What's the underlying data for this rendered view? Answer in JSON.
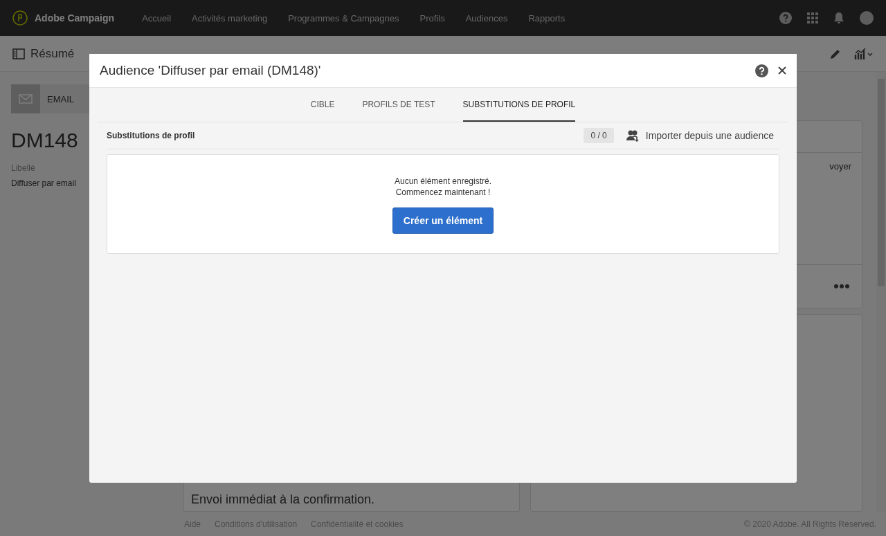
{
  "nav": {
    "brand": "Adobe Campaign",
    "items": [
      "Accueil",
      "Activités marketing",
      "Programmes & Campagnes",
      "Profils",
      "Audiences",
      "Rapports"
    ]
  },
  "subbar": {
    "label": "Résumé"
  },
  "left_panel": {
    "tab": "EMAIL",
    "name": "DM148",
    "field_label": "Libellé",
    "field_value": "Diffuser par email"
  },
  "main": {
    "right_card_text": "voyer",
    "schedule_text": "Envoi immédiat à la confirmation."
  },
  "footer": {
    "links": [
      "Aide",
      "Conditions d'utilisation",
      "Confidentialité et cookies"
    ],
    "copyright": "© 2020 Adobe. All Rights Reserved."
  },
  "dialog": {
    "title": "Audience 'Diffuser par email (DM148)'",
    "tabs": [
      {
        "label": "CIBLE",
        "selected": false
      },
      {
        "label": "PROFILS DE TEST",
        "selected": false
      },
      {
        "label": "SUBSTITUTIONS DE PROFIL",
        "selected": true
      }
    ],
    "section": {
      "title": "Substitutions de profil",
      "count": "0 / 0",
      "import_label": "Importer depuis une audience"
    },
    "empty": {
      "lines": [
        "Aucun élément enregistré.",
        "Commencez maintenant !"
      ],
      "button": "Créer un élément"
    }
  }
}
